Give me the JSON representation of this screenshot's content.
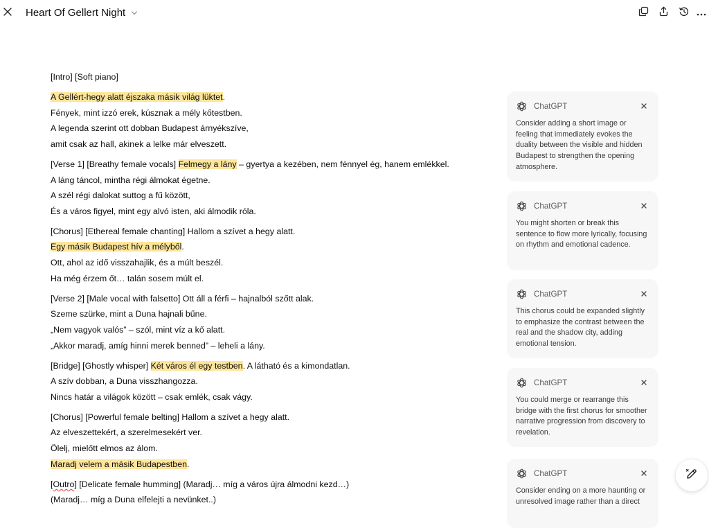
{
  "window": {
    "title": "Heart Of Gellert Night"
  },
  "top_actions": [
    {
      "name": "copy-icon"
    },
    {
      "name": "share-icon"
    },
    {
      "name": "history-icon"
    },
    {
      "name": "more-icon"
    }
  ],
  "colors": {
    "highlight": "#fde59a",
    "comment_bg": "#f7f7f7",
    "text": "#0d0d0d"
  },
  "document": {
    "paragraphs": [
      [
        [
          {
            "t": "[Intro] [Soft piano]"
          }
        ]
      ],
      [
        [
          {
            "t": "A Gellért-hegy alatt éjszaka másik világ lüktet",
            "hl": true
          },
          {
            "t": "."
          }
        ],
        [
          {
            "t": "Fények, mint izzó erek, kúsznak a mély kőtestben."
          }
        ],
        [
          {
            "t": "A legenda szerint ott dobban Budapest árnyékszíve,"
          }
        ],
        [
          {
            "t": "amit csak az hall, akinek a lelke már elveszett."
          }
        ]
      ],
      [
        [
          {
            "t": "[Verse 1] [Breathy female vocals] "
          },
          {
            "t": "Felmegy a lány",
            "hl": true
          },
          {
            "t": " – gyertya a kezében, nem fénnyel ég, hanem emlékkel."
          }
        ],
        [
          {
            "t": "A láng táncol, mintha régi álmokat égetne."
          }
        ],
        [
          {
            "t": "A szél régi dalokat suttog a fű között,"
          }
        ],
        [
          {
            "t": "És a város figyel, mint egy alvó isten, aki álmodik róla."
          }
        ]
      ],
      [
        [
          {
            "t": "[Chorus] [Ethereal female chanting] Hallom a szívet a hegy alatt."
          }
        ],
        [
          {
            "t": "Egy másik Budapest hív a mélyből",
            "hl": true
          },
          {
            "t": "."
          }
        ],
        [
          {
            "t": "Ott, ahol az idő visszahajlik, és a múlt beszél."
          }
        ],
        [
          {
            "t": "Ha még érzem őt… talán sosem múlt el."
          }
        ]
      ],
      [
        [
          {
            "t": "[Verse 2] [Male vocal with falsetto] Ott áll a férfi – hajnalból szőtt alak."
          }
        ],
        [
          {
            "t": "Szeme szürke, mint a Duna hajnali bűne."
          }
        ],
        [
          {
            "t": "„Nem vagyok valós” – szól, mint víz a kő alatt."
          }
        ],
        [
          {
            "t": "„Akkor maradj, amíg hinni merek benned” – leheli a lány."
          }
        ]
      ],
      [
        [
          {
            "t": "[Bridge] [Ghostly whisper] "
          },
          {
            "t": "Két város él egy testben",
            "hl": true
          },
          {
            "t": ". A látható és a kimondatlan."
          }
        ],
        [
          {
            "t": "A szív dobban, a Duna visszhangozza."
          }
        ],
        [
          {
            "t": "Nincs határ a világok között – csak emlék, csak vágy."
          }
        ]
      ],
      [
        [
          {
            "t": "[Chorus] [Powerful female belting] Hallom a szívet a hegy alatt."
          }
        ],
        [
          {
            "t": "Az elveszettekért, a szerelmesekért ver."
          }
        ],
        [
          {
            "t": "Ölelj, mielőtt elmos az álom."
          }
        ],
        [
          {
            "t": "Maradj velem a másik Budapestben",
            "hl": true
          },
          {
            "t": "."
          }
        ]
      ],
      [
        [
          {
            "t": "["
          },
          {
            "t": "Outro",
            "spell": true
          },
          {
            "t": "] [Delicate female humming] (Maradj… míg a város újra álmodni kezd…)"
          }
        ],
        [
          {
            "t": "(Maradj… míg a Duna elfelejti a nevünket..)"
          }
        ]
      ]
    ]
  },
  "comments": [
    {
      "author": "ChatGPT",
      "text": "Consider adding a short image or feeling that immediately evokes the duality between the visible and hidden Budapest to strengthen the opening atmosphere."
    },
    {
      "author": "ChatGPT",
      "text": "You might shorten or break this sentence to flow more lyrically, focusing on rhythm and emotional cadence."
    },
    {
      "author": "ChatGPT",
      "text": "This chorus could be expanded slightly to emphasize the contrast between the real and the shadow city, adding emotional tension."
    },
    {
      "author": "ChatGPT",
      "text": "You could merge or rearrange this bridge with the first chorus for smoother narrative progression from discovery to revelation."
    },
    {
      "author": "ChatGPT",
      "text": "Consider ending on a more haunting or unresolved image rather than a direct"
    }
  ],
  "fab": {
    "name": "edit-icon"
  }
}
